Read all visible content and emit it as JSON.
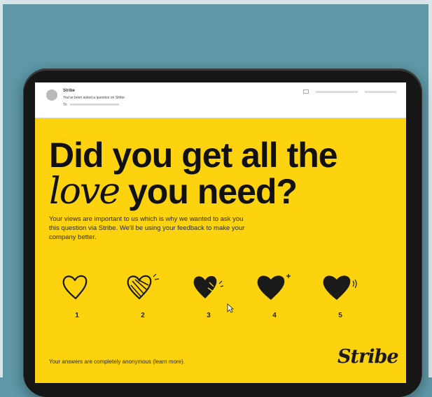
{
  "email": {
    "sender": "Stribe",
    "subject": "You've been asked a question on Stribe",
    "to_label": "To:"
  },
  "headline": {
    "line1": "Did you get all the",
    "script_word": "love",
    "line2_rest": " you need?"
  },
  "intro": "Your views are important to us which is why we wanted to ask you this question via Stribe. We'll be using your feedback to make your company better.",
  "ratings": [
    {
      "label": "1"
    },
    {
      "label": "2"
    },
    {
      "label": "3"
    },
    {
      "label": "4"
    },
    {
      "label": "5"
    }
  ],
  "footer": "Your answers are completely anonymous (learn more).",
  "brand": "Stribe",
  "colors": {
    "background": "#5e97a6",
    "screen": "#fcd30e",
    "ink": "#111111"
  }
}
